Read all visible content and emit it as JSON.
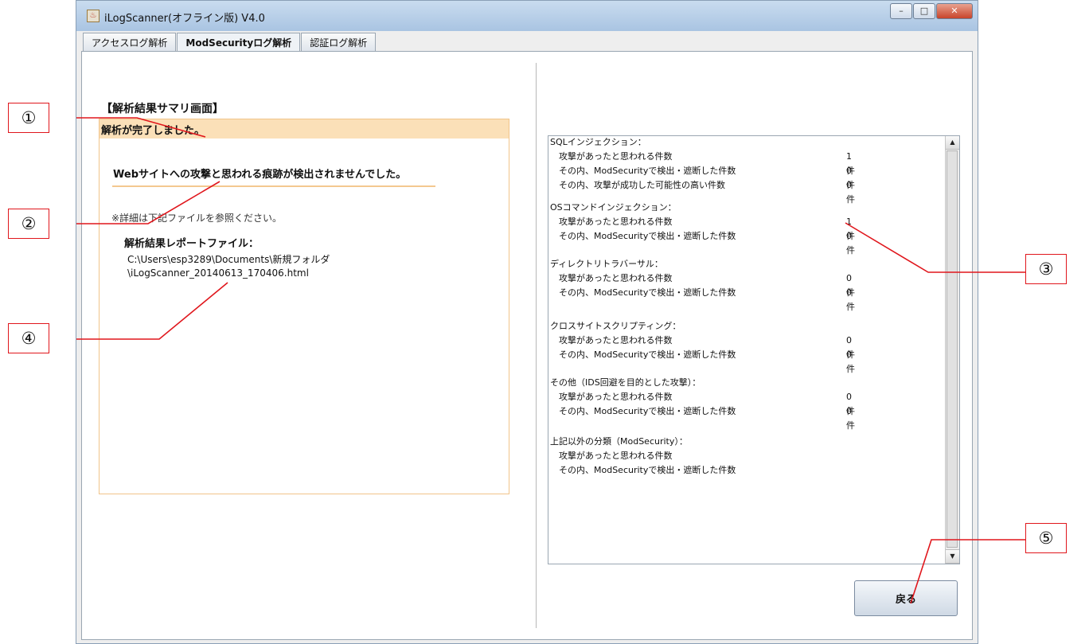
{
  "window": {
    "title": "iLogScanner(オフライン版) V4.0",
    "minimize": "–",
    "maximize": "□",
    "close": "✕"
  },
  "tabs": [
    {
      "label": "アクセスログ解析"
    },
    {
      "label": "ModSecurityログ解析"
    },
    {
      "label": "認証ログ解析"
    }
  ],
  "left": {
    "heading": "【解析結果サマリ画面】",
    "status": "解析が完了しました。",
    "no_trace": "Webサイトへの攻撃と思われる痕跡が検出されませんでした。",
    "note": "※詳細は下記ファイルを参照ください。",
    "report_label": "解析結果レポートファイル：",
    "report_path_1": "C:\\Users\\esp3289\\Documents\\新規フォルダ",
    "report_path_2": "\\iLogScanner_20140613_170406.html"
  },
  "groups": [
    {
      "title": "SQLインジェクション：",
      "rows": [
        {
          "label": "攻撃があったと思われる件数",
          "count": "1件"
        },
        {
          "label": "その内、ModSecurityで検出・遮断した件数",
          "count": "0件"
        },
        {
          "label": "その内、攻撃が成功した可能性の高い件数",
          "count": "0件"
        }
      ]
    },
    {
      "title": "OSコマンドインジェクション：",
      "rows": [
        {
          "label": "攻撃があったと思われる件数",
          "count": "1件"
        },
        {
          "label": "その内、ModSecurityで検出・遮断した件数",
          "count": "0件"
        }
      ]
    },
    {
      "title": "ディレクトリトラバーサル：",
      "rows": [
        {
          "label": "攻撃があったと思われる件数",
          "count": "0件"
        },
        {
          "label": "その内、ModSecurityで検出・遮断した件数",
          "count": "0件"
        }
      ]
    },
    {
      "title": "クロスサイトスクリプティング：",
      "rows": [
        {
          "label": "攻撃があったと思われる件数",
          "count": "0件"
        },
        {
          "label": "その内、ModSecurityで検出・遮断した件数",
          "count": "0件"
        }
      ]
    },
    {
      "title": "その他（IDS回避を目的とした攻撃）：",
      "rows": [
        {
          "label": "攻撃があったと思われる件数",
          "count": "0件"
        },
        {
          "label": "その内、ModSecurityで検出・遮断した件数",
          "count": "0件"
        }
      ]
    },
    {
      "title": "上記以外の分類（ModSecurity）：",
      "rows": [
        {
          "label": "攻撃があったと思われる件数",
          "count": ""
        },
        {
          "label": "その内、ModSecurityで検出・遮断した件数",
          "count": ""
        }
      ]
    }
  ],
  "back_button": "戻る",
  "scroll_up": "▲",
  "scroll_down": "▼",
  "callouts": [
    "①",
    "②",
    "③",
    "④",
    "⑤"
  ],
  "accent": {
    "callout_red": "#e0161c",
    "result_header": "#fbe0b8"
  }
}
